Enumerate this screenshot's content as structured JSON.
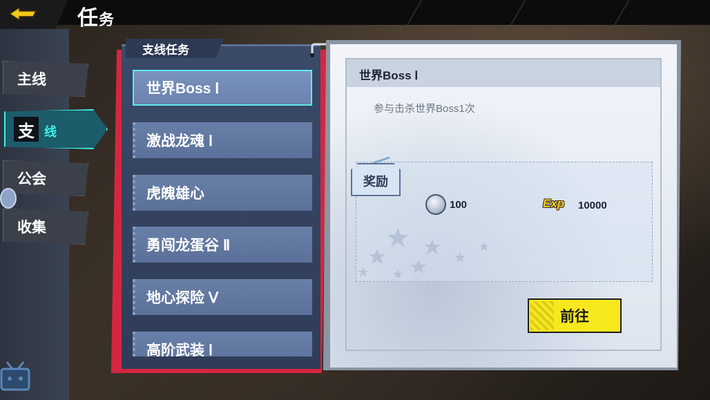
{
  "header": {
    "title_big": "任",
    "title_small": "务"
  },
  "side_tabs": [
    {
      "label": "主线"
    },
    {
      "label_box": "支",
      "label_rest": "线"
    },
    {
      "label": "公会"
    },
    {
      "label": "收集"
    }
  ],
  "task_list": {
    "title": "支线任务",
    "items": [
      {
        "label": "世界Boss Ⅰ"
      },
      {
        "label": "激战龙魂 Ⅰ"
      },
      {
        "label": "虎魄雄心"
      },
      {
        "label": "勇闯龙蛋谷 Ⅱ"
      },
      {
        "label": "地心探险 Ⅴ"
      },
      {
        "label": "高阶武装 Ⅰ"
      }
    ]
  },
  "detail": {
    "title": "世界Boss Ⅰ",
    "description": "参与击杀世界Boss1次",
    "reward_tag": "奖励",
    "rewards": [
      {
        "icon": "silver-coin-icon",
        "amount": "100"
      },
      {
        "icon": "exp-icon",
        "icon_text": "Exp",
        "amount": "10000"
      }
    ],
    "go_button": "前往"
  },
  "colors": {
    "accent_cyan": "#3ef2e8",
    "button_yellow": "#f8e81e",
    "list_red": "#d6263f"
  }
}
